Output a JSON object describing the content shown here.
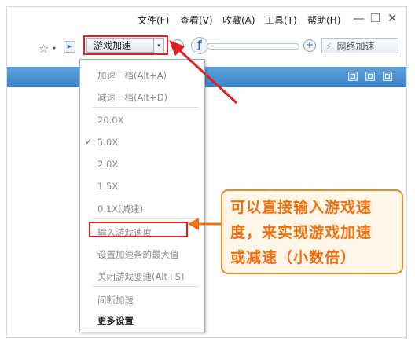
{
  "menubar": {
    "items": [
      "文件(F)",
      "查看(V)",
      "收藏(A)",
      "工具(T)",
      "帮助(H)"
    ],
    "window_buttons": {
      "minimize": "—",
      "restore": "❐",
      "close": "✕"
    }
  },
  "toolbar": {
    "favorites_icon": "☆",
    "dropdown_caret": "▾",
    "forward_icon": "▶",
    "game_speed_label": "游戏加速",
    "game_speed_caret": "▾",
    "decrease_symbol": "−",
    "runner_icon": "ƒ",
    "increase_symbol": "+",
    "network_bolt": "⚡",
    "network_speed_label": "网络加速"
  },
  "dropdown": {
    "items": [
      {
        "label": "加速一档(Alt+A)",
        "style": "grey"
      },
      {
        "label": "减速一档(Alt+D)",
        "style": "grey"
      },
      {
        "label": "20.0X",
        "style": "grey"
      },
      {
        "label": "5.0X",
        "style": "grey",
        "checked": true
      },
      {
        "label": "2.0X",
        "style": "grey"
      },
      {
        "label": "1.5X",
        "style": "grey"
      },
      {
        "label": "0.1X(减速)",
        "style": "grey"
      },
      {
        "label": "输入游戏速度",
        "style": "grey",
        "highlighted": true
      },
      {
        "label": "设置加速条的最大值",
        "style": "grey"
      },
      {
        "label": "关闭游戏变速(Alt+S)",
        "style": "grey"
      },
      {
        "label": "间断加速",
        "style": "grey"
      },
      {
        "label": "更多设置",
        "style": "bold"
      }
    ],
    "check_mark": "✓"
  },
  "callout": {
    "lines": [
      "可以直接输入游戏速",
      "度，来实现游戏加速",
      "或减速（小数倍）"
    ]
  },
  "colors": {
    "annotation_red": "#e02020",
    "callout_orange": "#f07010",
    "header_blue": "#3b82c8"
  }
}
